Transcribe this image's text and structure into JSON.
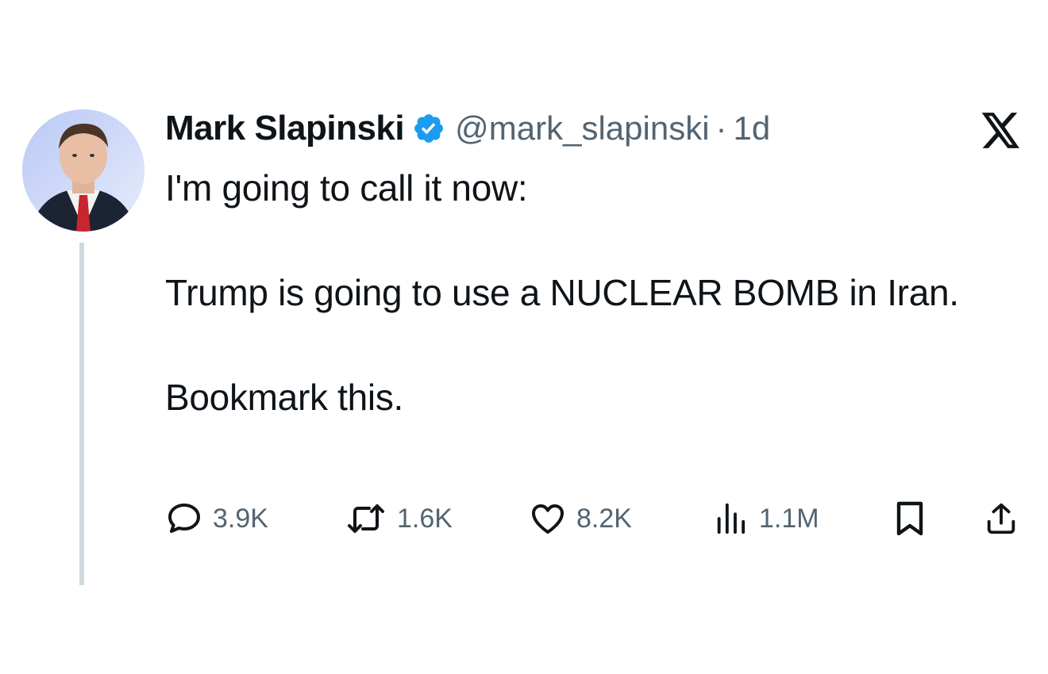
{
  "tweet": {
    "author": {
      "display_name": "Mark Slapinski",
      "handle": "@mark_slapinski",
      "verified": true,
      "avatar": "profile-photo"
    },
    "separator": "·",
    "time": "1d",
    "brand_icon": "x-logo-icon",
    "body": {
      "line1": "I'm going to call it now:",
      "line2": "Trump is going to use a NUCLEAR BOMB in Iran.",
      "line3": "Bookmark this."
    },
    "actions": {
      "replies": "3.9K",
      "reposts": "1.6K",
      "likes": "8.2K",
      "views": "1.1M"
    },
    "icons": {
      "reply": "reply-icon",
      "repost": "repost-icon",
      "like": "heart-icon",
      "views": "views-icon",
      "bookmark": "bookmark-icon",
      "share": "share-icon"
    },
    "colors": {
      "text": "#0f1419",
      "secondary": "#536471",
      "verified_badge": "#1d9bf0",
      "thread_line": "#cfd9de"
    }
  }
}
